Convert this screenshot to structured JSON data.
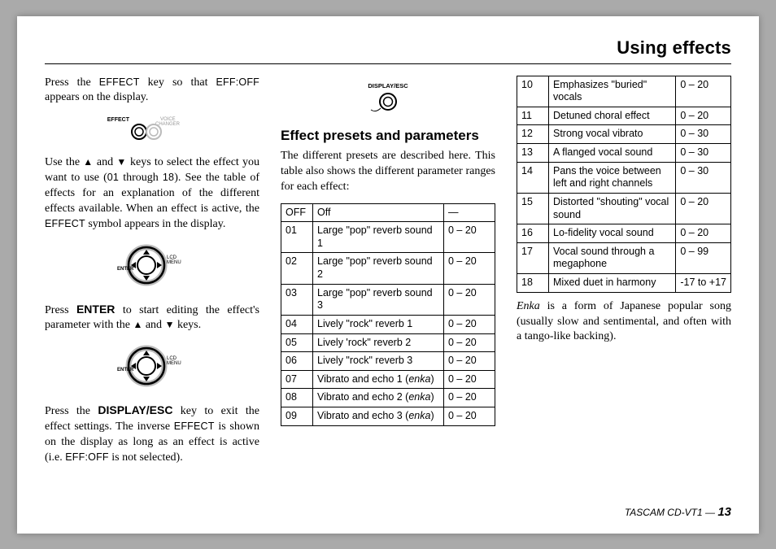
{
  "header": {
    "title": "Using effects"
  },
  "col1": {
    "p1a": "Press the ",
    "p1b": " key so that ",
    "p1c": " appears on the display.",
    "effect_label": "EFFECT",
    "effoff_label": "EFF:OFF",
    "fig1_main": "EFFECT",
    "fig1_aux": "VOICE CHANGER",
    "p2a": "Use the ",
    "p2b": " and ",
    "p2c": " keys to select the effect you want to use (",
    "p2d": " through ",
    "p2e": "). See the table of effects for an explanation of the different effects available. When an effect is active, the ",
    "p2f": " symbol appears in the display.",
    "code01": "01",
    "code18": "18",
    "fig2_lcd": "LCD",
    "fig2_menu": "MENU",
    "fig2_enter": "ENTER",
    "p3a": "Press ",
    "p3b": " to start editing the effect's parameter with the ",
    "p3c": " and ",
    "p3d": " keys.",
    "enter_label": "ENTER",
    "p4a": "Press the ",
    "p4b": " key to exit the effect settings. The inverse ",
    "p4c": " is shown on the display as long as an effect is active (i.e. ",
    "p4d": " is not selected).",
    "display_esc_label": "DISPLAY/ESC"
  },
  "col2": {
    "fig_label": "DISPLAY/ESC",
    "heading": "Effect presets and parameters",
    "intro": "The different presets are described here. This table also shows the different parameter ranges for each effect:",
    "rows": [
      {
        "n": "OFF",
        "d": "Off",
        "r": "—"
      },
      {
        "n": "01",
        "d": "Large \"pop\" reverb sound 1",
        "r": "0 – 20"
      },
      {
        "n": "02",
        "d": "Large \"pop\" reverb sound 2",
        "r": "0 – 20"
      },
      {
        "n": "03",
        "d": "Large \"pop\" reverb sound 3",
        "r": "0 – 20"
      },
      {
        "n": "04",
        "d": "Lively \"rock\" reverb 1",
        "r": "0 – 20"
      },
      {
        "n": "05",
        "d": "Lively 'rock\" reverb 2",
        "r": "0 – 20"
      },
      {
        "n": "06",
        "d": "Lively  \"rock\" reverb 3",
        "r": "0 – 20"
      },
      {
        "n": "07",
        "d": "Vibrato and echo 1 (<i>enka</i>)",
        "r": "0 – 20"
      },
      {
        "n": "08",
        "d": "Vibrato and echo 2 (<i>enka</i>)",
        "r": "0 – 20"
      },
      {
        "n": "09",
        "d": "Vibrato and echo 3 (<i>enka</i>)",
        "r": "0 – 20"
      }
    ]
  },
  "col3": {
    "rows": [
      {
        "n": "10",
        "d": "Emphasizes \"buried\" vocals",
        "r": "0 – 20"
      },
      {
        "n": "11",
        "d": "Detuned choral effect",
        "r": "0 – 20"
      },
      {
        "n": "12",
        "d": "Strong vocal vibrato",
        "r": "0 – 30"
      },
      {
        "n": "13",
        "d": "A flanged vocal sound",
        "r": "0 – 30"
      },
      {
        "n": "14",
        "d": "Pans the voice between left and right channels",
        "r": "0 – 30"
      },
      {
        "n": "15",
        "d": "Distorted \"shouting\" vocal sound",
        "r": "0 – 20"
      },
      {
        "n": "16",
        "d": "Lo-fidelity vocal sound",
        "r": "0 – 20"
      },
      {
        "n": "17",
        "d": "Vocal sound through a megaphone",
        "r": "0 – 99"
      },
      {
        "n": "18",
        "d": "Mixed duet in harmony",
        "r": "-17 to +17"
      }
    ],
    "note_a": "Enka",
    "note_b": " is a form of Japanese popular song (usually slow and sentimental, and often with a tango-like backing)."
  },
  "footer": {
    "product": "TASCAM CD-VT1 — ",
    "page": "13"
  }
}
